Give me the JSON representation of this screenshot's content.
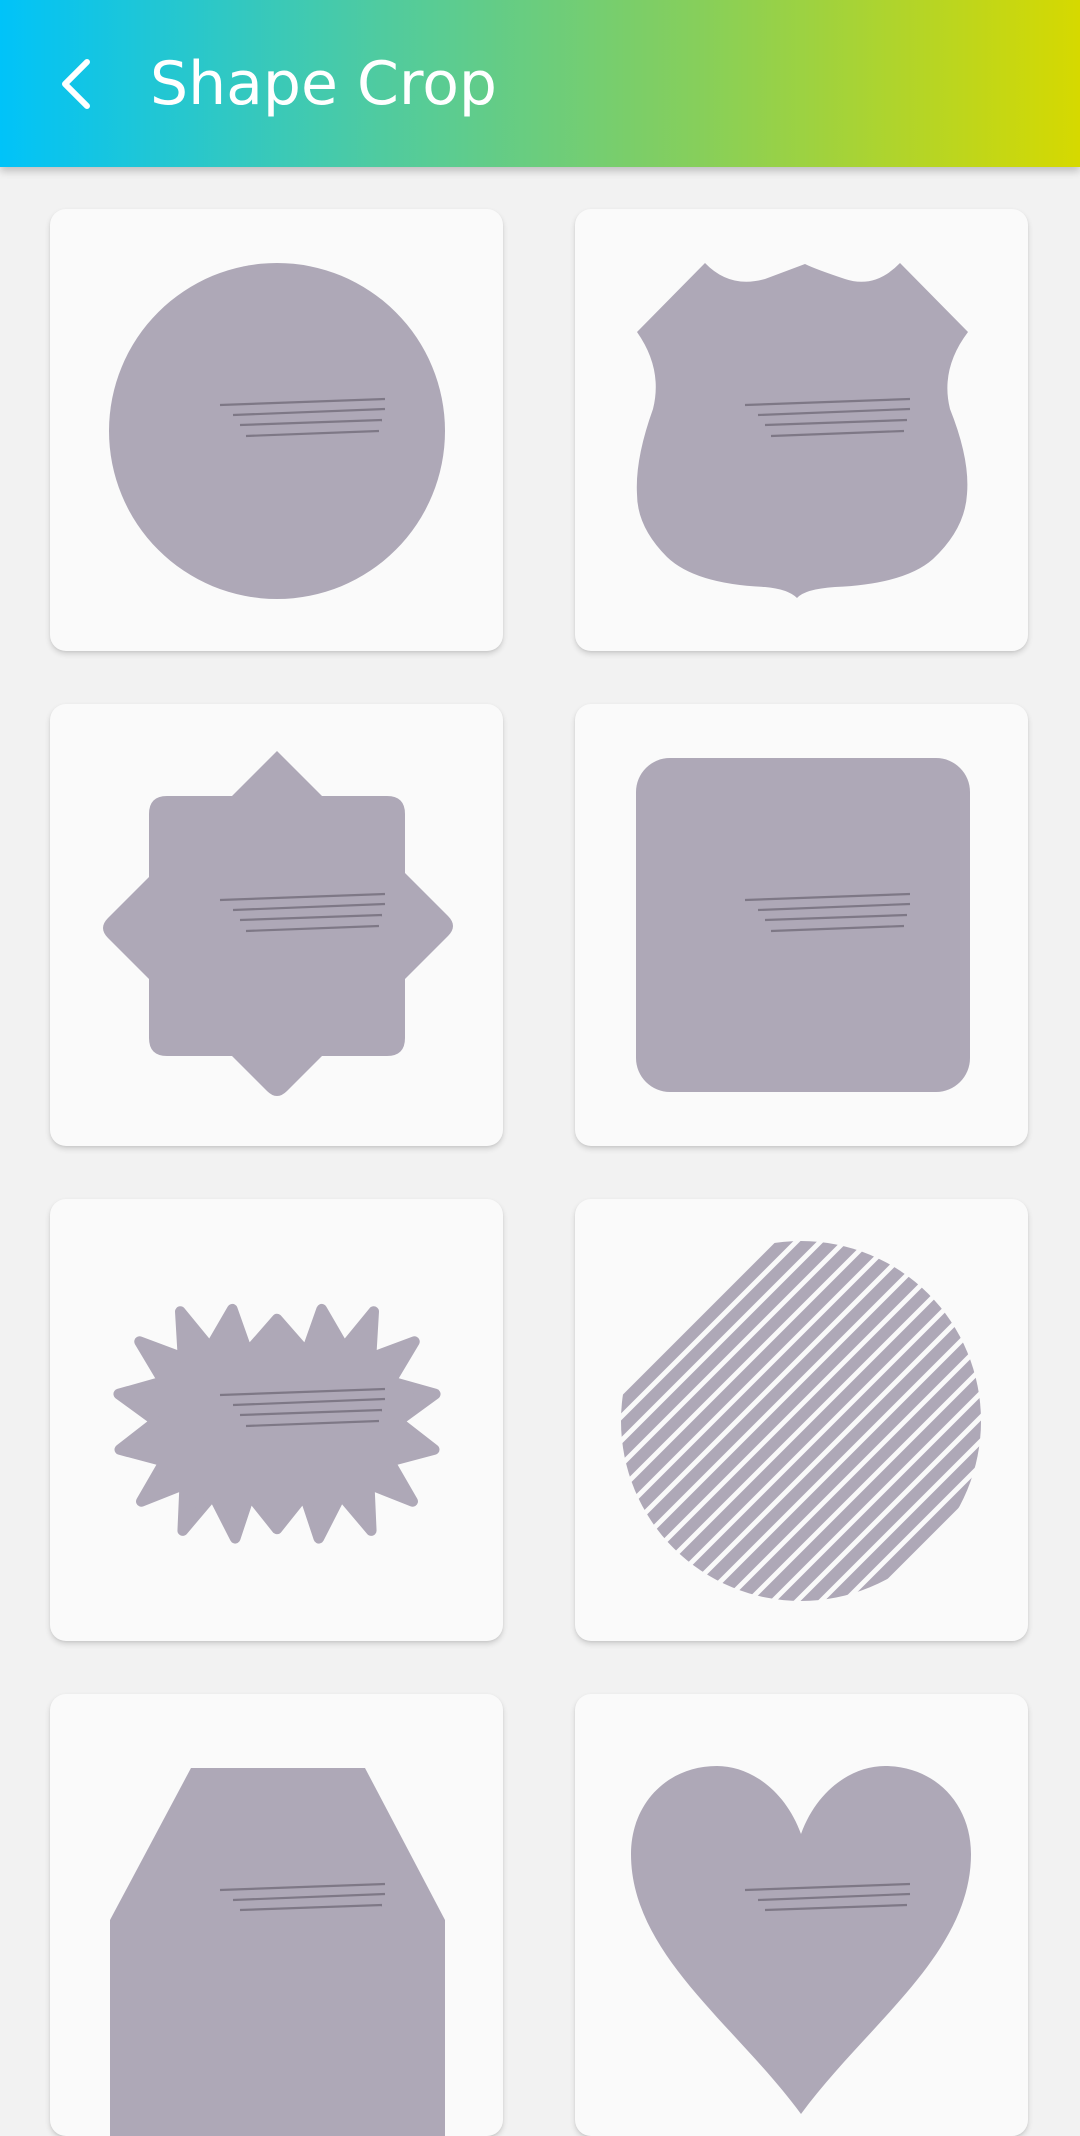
{
  "app_bar": {
    "title": "Shape Crop",
    "back_icon": "chevron-left-icon",
    "gradient_colors": [
      "#00c3f9",
      "#4fcba0",
      "#87cf5a",
      "#d6d900"
    ]
  },
  "shapes": [
    {
      "name": "circle"
    },
    {
      "name": "shield"
    },
    {
      "name": "eight-point-star"
    },
    {
      "name": "rounded-square"
    },
    {
      "name": "ten-point-star"
    },
    {
      "name": "striped-circle"
    },
    {
      "name": "trapezoid"
    },
    {
      "name": "heart"
    }
  ],
  "colors": {
    "shape_fill": "#aea8b7",
    "card_background": "#fafafa",
    "page_background": "#f2f2f2"
  }
}
